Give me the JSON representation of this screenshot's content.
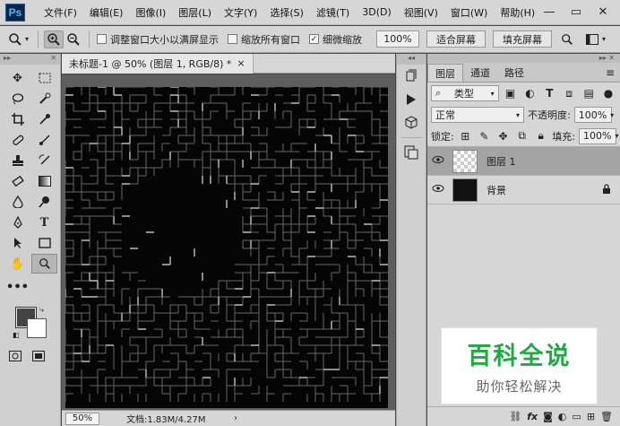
{
  "app": {
    "logo": "Ps"
  },
  "menu": [
    "文件(F)",
    "编辑(E)",
    "图像(I)",
    "图层(L)",
    "文字(Y)",
    "选择(S)",
    "滤镜(T)",
    "3D(D)",
    "视图(V)",
    "窗口(W)",
    "帮助(H)"
  ],
  "window_controls": {
    "minimize": "—",
    "restore": "▭",
    "close": "✕"
  },
  "options": {
    "resize_windows_label": "调整窗口大小以满屏显示",
    "zoom_all_label": "缩放所有窗口",
    "scrubby_zoom_label": "细微缩放",
    "scrubby_zoom_checked": true,
    "zoom_value": "100%",
    "fit_screen_label": "适合屏幕",
    "fill_screen_label": "填充屏幕"
  },
  "document": {
    "tab_title": "未标题-1 @ 50% (图层 1, RGB/8) *",
    "close_glyph": "×",
    "zoom": "50%",
    "doc_info": "文档:1.83M/4.27M",
    "status_arrow": "›"
  },
  "layers_panel": {
    "tabs": [
      "图层",
      "通道",
      "路径"
    ],
    "filter_kind": "类型",
    "blend_mode": "正常",
    "opacity_label": "不透明度:",
    "opacity_value": "100%",
    "lock_label": "锁定:",
    "fill_label": "填充:",
    "fill_value": "100%",
    "layers": [
      {
        "name": "图层 1",
        "selected": true,
        "thumb": "transparent",
        "locked": false
      },
      {
        "name": "背景",
        "selected": false,
        "thumb": "dark",
        "locked": true
      }
    ]
  },
  "watermark": {
    "title": "百科全说",
    "subtitle": "助你轻松解决"
  }
}
